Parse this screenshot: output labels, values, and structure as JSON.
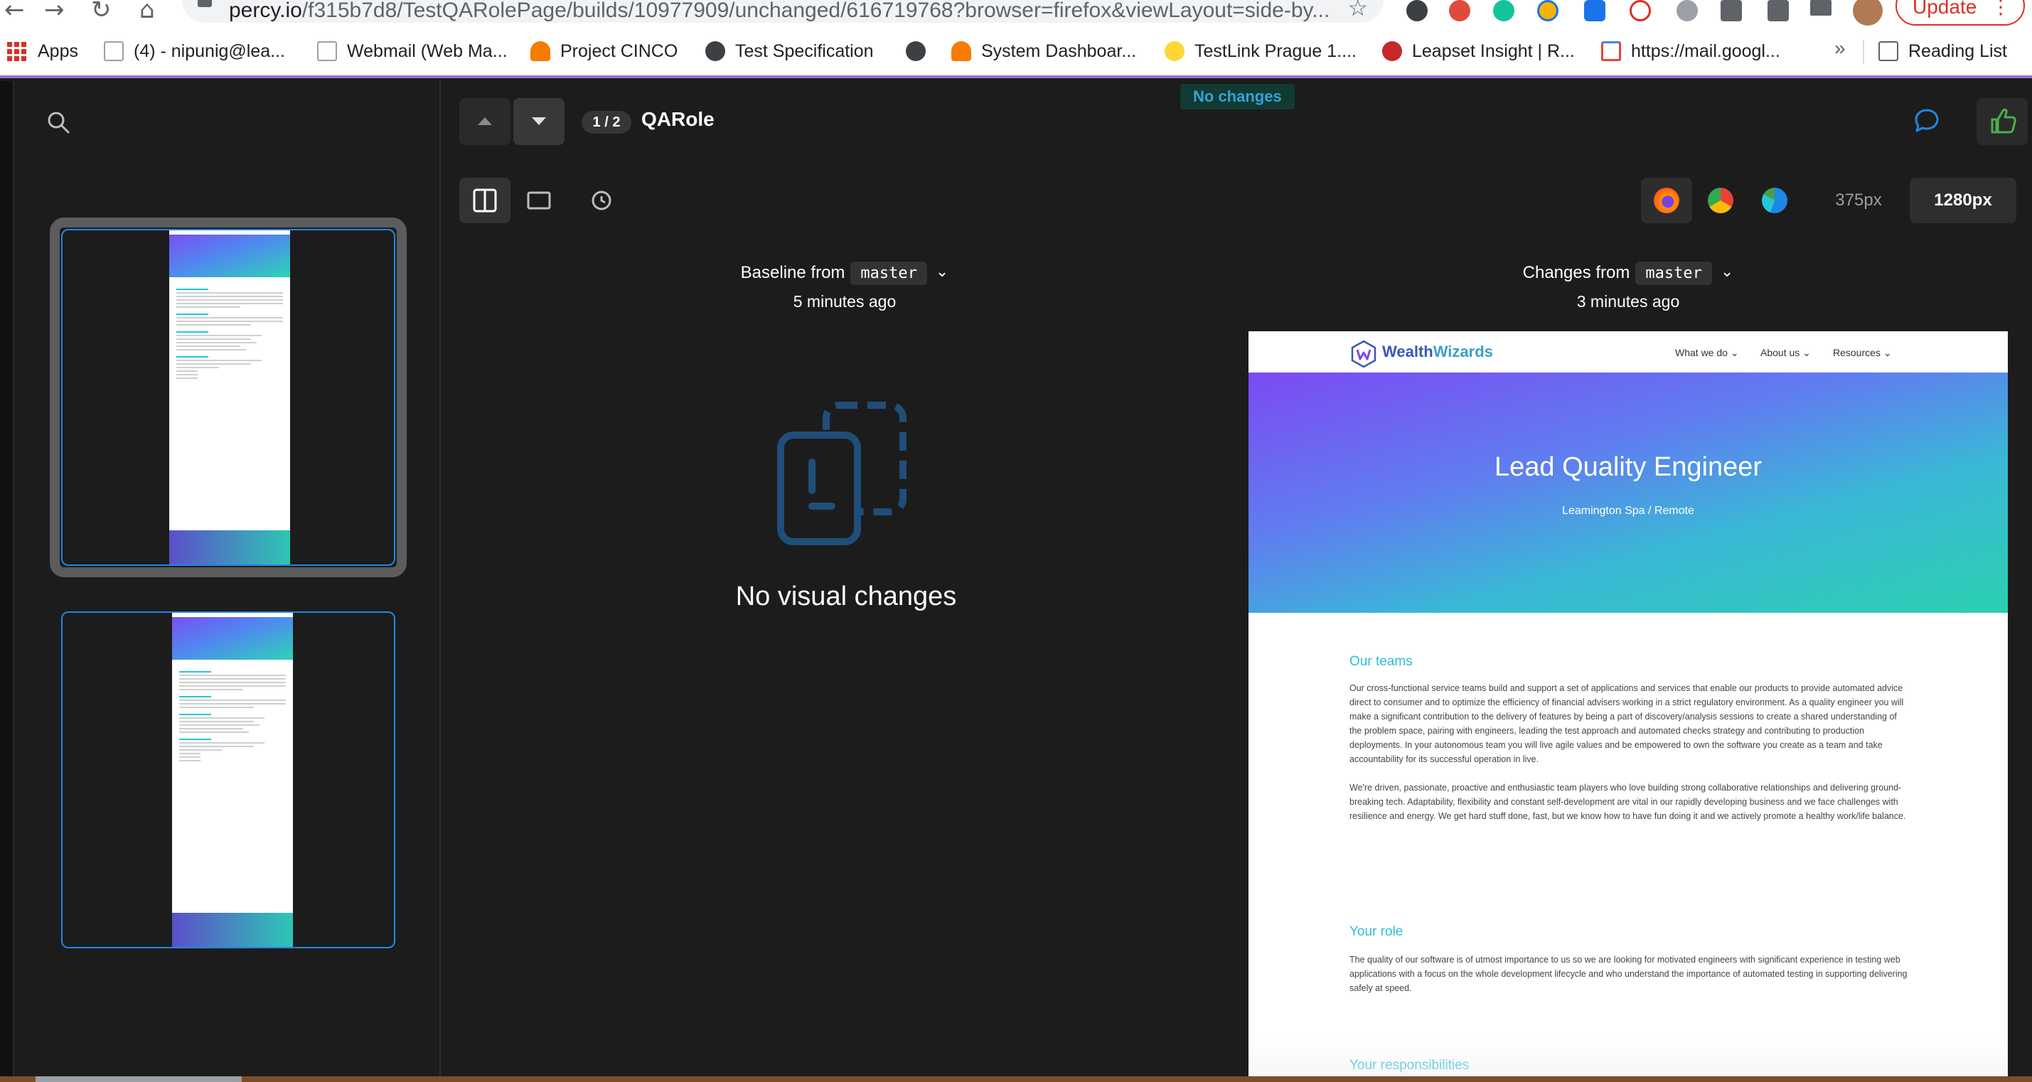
{
  "browser": {
    "url_host": "percy.io",
    "url_path": "/f315b7d8/TestQARolePage/builds/10977909/unchanged/616719768?browser=firefox&viewLayout=side-by...",
    "update_label": "Update",
    "update_dots": "⋮",
    "bookmarks": [
      {
        "label": "Apps"
      },
      {
        "label": "(4) - nipunig@lea..."
      },
      {
        "label": "Webmail (Web Ma..."
      },
      {
        "label": "Project CINCO"
      },
      {
        "label": "Test Specification"
      },
      {
        "label": ""
      },
      {
        "label": "System Dashboar..."
      },
      {
        "label": "TestLink Prague 1...."
      },
      {
        "label": "Leapset Insight | R..."
      },
      {
        "label": "https://mail.googl..."
      }
    ],
    "more_label": "»",
    "reading_list": "Reading List"
  },
  "header": {
    "counter": "1 / 2",
    "snapshot_name": "QARole",
    "status_badge": "No changes"
  },
  "widths": [
    "375px",
    "1280px"
  ],
  "baseline": {
    "label": "Baseline from",
    "branch": "master",
    "time": "5 minutes ago"
  },
  "changes": {
    "label": "Changes from",
    "branch": "master",
    "time": "3 minutes ago"
  },
  "empty_state": {
    "message": "No visual changes"
  },
  "site": {
    "logo": {
      "part1": "Wealth",
      "part2": "Wizards"
    },
    "menu": [
      "What we do",
      "About us",
      "Resources"
    ],
    "hero_title": "Lead Quality Engineer",
    "hero_sub": "Leamington Spa / Remote",
    "sections": [
      {
        "title": "Our teams",
        "body": "Our cross-functional service teams build and support a set of applications and services that enable our products to provide automated advice direct to consumer and to optimize the efficiency of financial advisers working in a strict regulatory environment. As a quality engineer you will make a significant contribution to the delivery of features by being a part of discovery/analysis sessions to create a shared understanding of the problem space, pairing with engineers, leading the test approach and automated checks strategy and contributing to production deployments. In your autonomous team you will live agile values and be empowered to own the software you create as a team and take accountability for its successful operation in live."
      },
      {
        "title": "",
        "body": "We're driven, passionate, proactive and enthusiastic team players who love building strong collaborative relationships and delivering ground-breaking tech. Adaptability, flexibility and constant self-development are vital in our rapidly developing business and we face challenges with resilience and energy. We get hard stuff done, fast, but we know how to have fun doing it and we actively promote a healthy work/life balance."
      },
      {
        "title": "Your role",
        "body": "The quality of our software is of utmost importance to us so we are looking for motivated engineers with significant experience in testing web applications with a focus on the whole development lifecycle and who understand the importance of automated testing in supporting delivering safely at speed."
      },
      {
        "title": "Your responsibilities",
        "body": ""
      }
    ]
  },
  "colors": {
    "accent_blue": "#1e88e5",
    "status_text": "#34a3d8",
    "approve_green": "#4caf50",
    "site_teal": "#2cc0d8"
  }
}
